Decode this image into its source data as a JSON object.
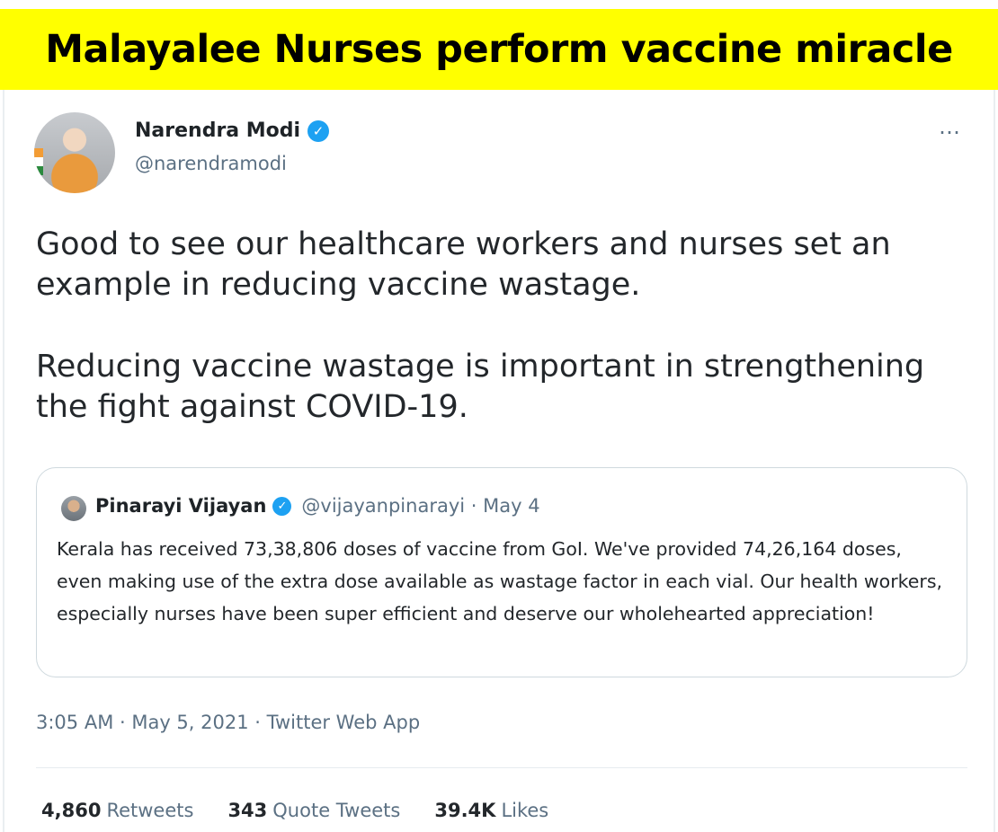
{
  "banner": {
    "title": "Malayalee Nurses perform vaccine miracle"
  },
  "tweet": {
    "author_name": "Narendra Modi",
    "author_handle": "@narendramodi",
    "more_icon": "⋯",
    "paragraphs": [
      "Good to see our healthcare workers and nurses set an example in reducing vaccine wastage.",
      "Reducing vaccine wastage is important in strengthening the fight against COVID-19."
    ],
    "meta": "3:05 AM · May 5, 2021 · Twitter Web App",
    "stats": {
      "retweets_count": "4,860",
      "retweets_label": "Retweets",
      "quotes_count": "343",
      "quotes_label": "Quote Tweets",
      "likes_count": "39.4K",
      "likes_label": "Likes"
    }
  },
  "quoted": {
    "author_name": "Pinarayi Vijayan",
    "handle_date": "@vijayanpinarayi · May 4",
    "text": "Kerala has received 73,38,806 doses of vaccine from GoI. We've provided 74,26,164 doses, even making use of the extra dose available as wastage factor in each vial. Our health workers, especially nurses have been super efficient and deserve our wholehearted appreciation!"
  },
  "colors": {
    "banner_bg": "#ffff00",
    "verified": "#1da1f2",
    "secondary_text": "#5b7083"
  }
}
